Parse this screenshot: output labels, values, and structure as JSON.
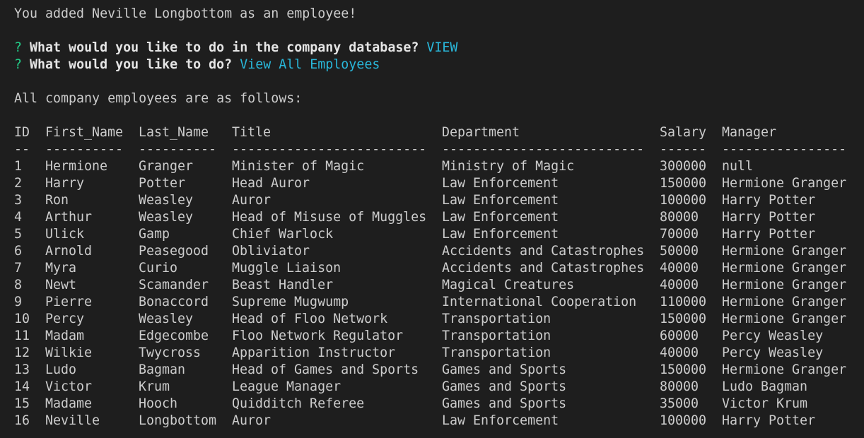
{
  "terminal": {
    "added_message": "You added Neville Longbottom as an employee!",
    "prompts": [
      {
        "mark": "?",
        "question": "What would you like to do in the company database?",
        "answer": "VIEW"
      },
      {
        "mark": "?",
        "question": "What would you like to do?",
        "answer": "View All Employees"
      }
    ],
    "intro": "All company employees are as follows:"
  },
  "table": {
    "headers": [
      "ID",
      "First_Name",
      "Last_Name",
      "Title",
      "Department",
      "Salary",
      "Manager"
    ],
    "separators": [
      "--",
      "----------",
      "----------",
      "-------------------------",
      "--------------------------",
      "------",
      "----------------"
    ],
    "rows": [
      [
        "1",
        "Hermione",
        "Granger",
        "Minister of Magic",
        "Ministry of Magic",
        "300000",
        "null"
      ],
      [
        "2",
        "Harry",
        "Potter",
        "Head Auror",
        "Law Enforcement",
        "150000",
        "Hermione Granger"
      ],
      [
        "3",
        "Ron",
        "Weasley",
        "Auror",
        "Law Enforcement",
        "100000",
        "Harry Potter"
      ],
      [
        "4",
        "Arthur",
        "Weasley",
        "Head of Misuse of Muggles",
        "Law Enforcement",
        "80000",
        "Harry Potter"
      ],
      [
        "5",
        "Ulick",
        "Gamp",
        "Chief Warlock",
        "Law Enforcement",
        "70000",
        "Harry Potter"
      ],
      [
        "6",
        "Arnold",
        "Peasegood",
        "Obliviator",
        "Accidents and Catastrophes",
        "50000",
        "Hermione Granger"
      ],
      [
        "7",
        "Myra",
        "Curio",
        "Muggle Liaison",
        "Accidents and Catastrophes",
        "40000",
        "Hermione Granger"
      ],
      [
        "8",
        "Newt",
        "Scamander",
        "Beast Handler",
        "Magical Creatures",
        "40000",
        "Hermione Granger"
      ],
      [
        "9",
        "Pierre",
        "Bonaccord",
        "Supreme Mugwump",
        "International Cooperation",
        "110000",
        "Hermione Granger"
      ],
      [
        "10",
        "Percy",
        "Weasley",
        "Head of Floo Network",
        "Transportation",
        "150000",
        "Hermione Granger"
      ],
      [
        "11",
        "Madam",
        "Edgecombe",
        "Floo Network Regulator",
        "Transportation",
        "60000",
        "Percy Weasley"
      ],
      [
        "12",
        "Wilkie",
        "Twycross",
        "Apparition Instructor",
        "Transportation",
        "40000",
        "Percy Weasley"
      ],
      [
        "13",
        "Ludo",
        "Bagman",
        "Head of Games and Sports",
        "Games and Sports",
        "150000",
        "Hermione Granger"
      ],
      [
        "14",
        "Victor",
        "Krum",
        "League Manager",
        "Games and Sports",
        "80000",
        "Ludo Bagman"
      ],
      [
        "15",
        "Madame",
        "Hooch",
        "Quidditch Referee",
        "Games and Sports",
        "35000",
        "Victor Krum"
      ],
      [
        "16",
        "Neville",
        "Longbottom",
        "Auror",
        "Law Enforcement",
        "100000",
        "Harry Potter"
      ]
    ]
  }
}
